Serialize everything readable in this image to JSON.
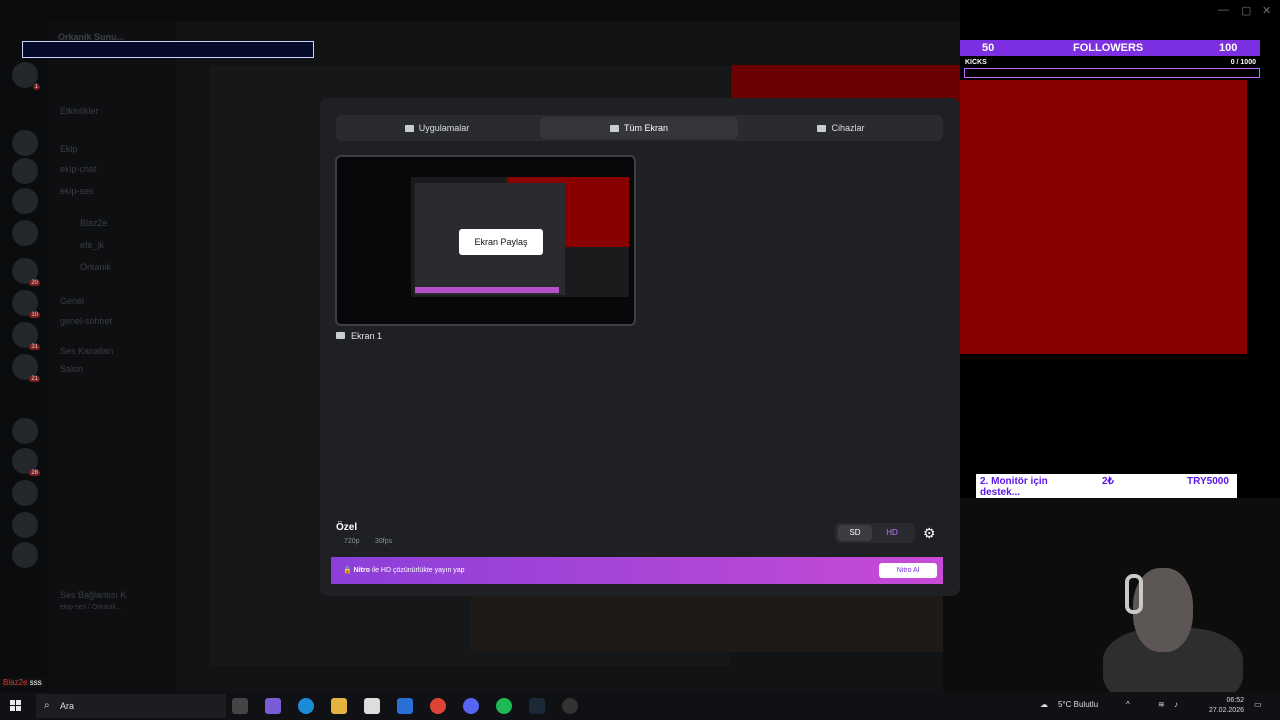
{
  "window_title": "Orkanik Sunucusu",
  "sidebar": {
    "server_name": "Orkanik Sunu...",
    "events": "Etkinlikler",
    "category_ekip": "Ekip",
    "channels": [
      "ekip-chat",
      "ekip-ses"
    ],
    "voice_users": [
      "Blaz2e",
      "efe_jk",
      "Orkanik"
    ],
    "category_genel": "Genel",
    "genel_channel": "genel-sohbet",
    "category_voice": "Ses Kanalları",
    "voice_channel": "Salon",
    "voice_connected": "Ses Bağlantısı K",
    "voice_sub": "ekip-ses / Orkanik...",
    "bottom_user": "Blaz2e",
    "bottom_badge": "sss"
  },
  "overlay": {
    "followers_left": "50",
    "followers_label": "FOLLOWERS",
    "followers_right": "100",
    "kicks_label": "KICKS",
    "kicks_value": "0 / 1000",
    "goal_text": "2. Monitör için destek...",
    "goal_amount": "2₺",
    "goal_target": "TRY5000"
  },
  "dialog": {
    "tabs": [
      {
        "label": "Uygulamalar",
        "active": false
      },
      {
        "label": "Tüm Ekran",
        "active": true
      },
      {
        "label": "Cihazlar",
        "active": false
      }
    ],
    "screen_name": "Ekran 1",
    "preview_popup": "Ekran Paylaş",
    "quality_title": "Özel",
    "resolution": "720p",
    "fps": "30fps",
    "sd_label": "SD",
    "hd_label": "HD",
    "nitro_brand": "Nitro",
    "nitro_text": "ile HD çözünürlükte yayın yap",
    "nitro_button": "Nitro Al"
  },
  "taskbar": {
    "search_label": "Ara",
    "weather": "5°C Bulutlu",
    "time": "06:52",
    "date": "27.02.2026"
  },
  "colors": {
    "accent_purple": "#7b2fe0",
    "nitro_pink": "#c74bd6",
    "overlay_red": "#8a0000"
  }
}
